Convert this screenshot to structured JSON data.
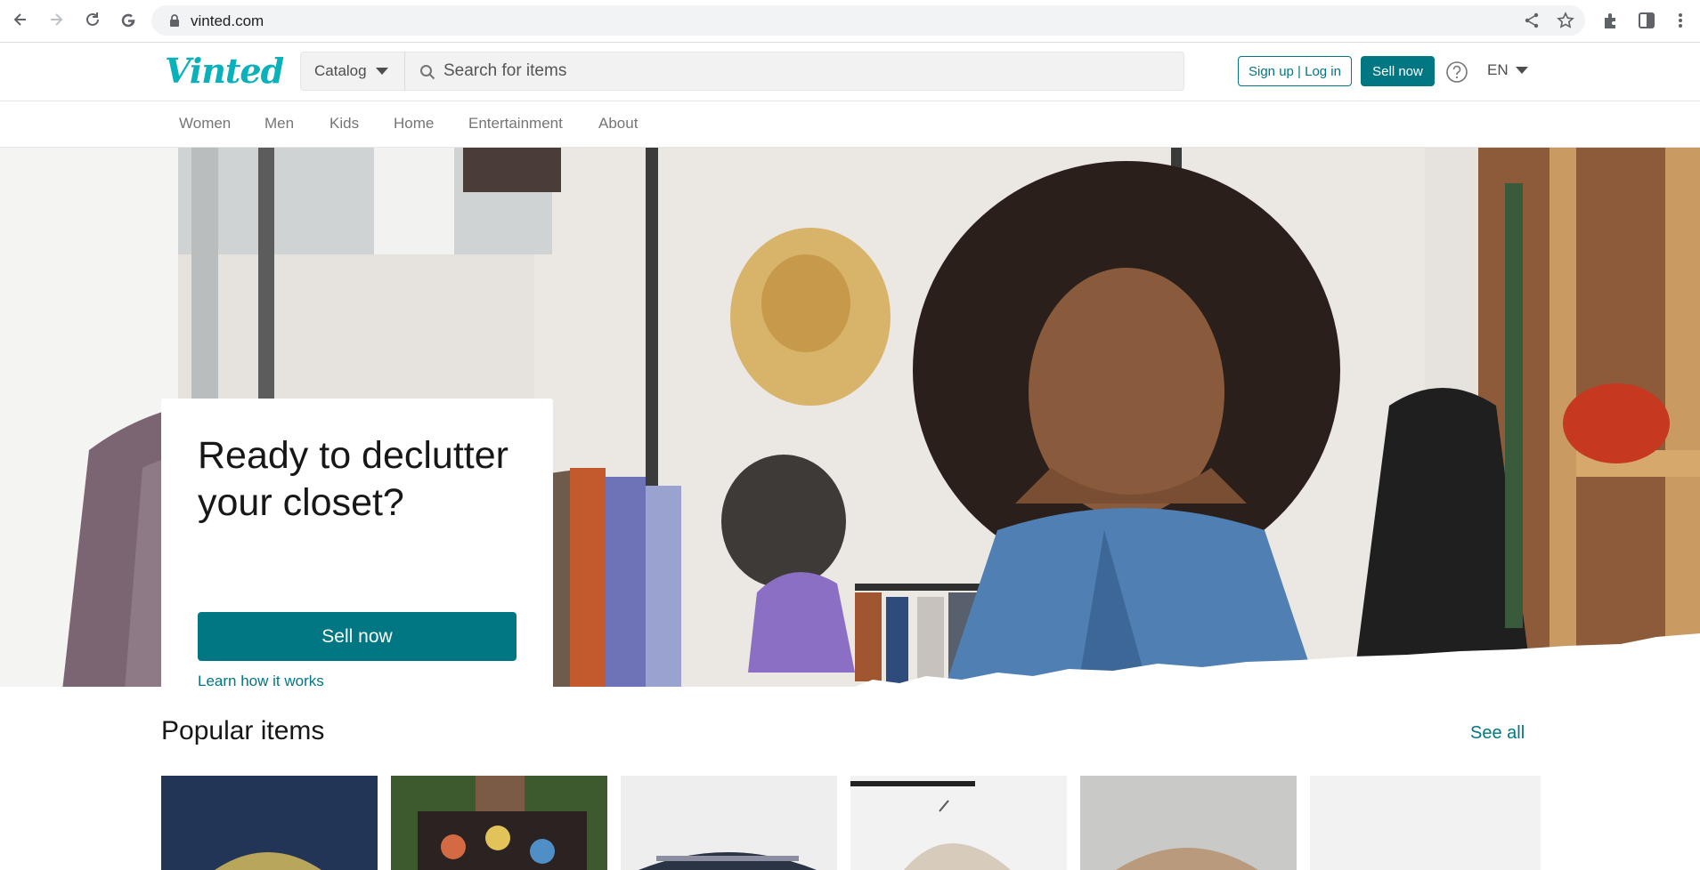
{
  "browser": {
    "url": "vinted.com",
    "icons": [
      "back-icon",
      "forward-icon",
      "reload-icon",
      "google-icon",
      "lock-icon",
      "share-icon",
      "star-icon",
      "extensions-icon",
      "sidepanel-icon",
      "kebab-menu-icon"
    ]
  },
  "header": {
    "logo": "Vinted",
    "catalog_label": "Catalog",
    "search_placeholder": "Search for items",
    "signup_label": "Sign up | Log in",
    "sell_label": "Sell now",
    "lang_label": "EN"
  },
  "catnav": {
    "items": [
      {
        "label": "Women"
      },
      {
        "label": "Men"
      },
      {
        "label": "Kids"
      },
      {
        "label": "Home"
      },
      {
        "label": "Entertainment"
      },
      {
        "label": "About"
      }
    ]
  },
  "hero": {
    "title": "Ready to declutter your closet?",
    "sell_label": "Sell now",
    "learn_label": "Learn how it works"
  },
  "popular": {
    "title": "Popular items",
    "see_all": "See all"
  },
  "colors": {
    "brand": "#09b1ba",
    "accent": "#007782"
  }
}
